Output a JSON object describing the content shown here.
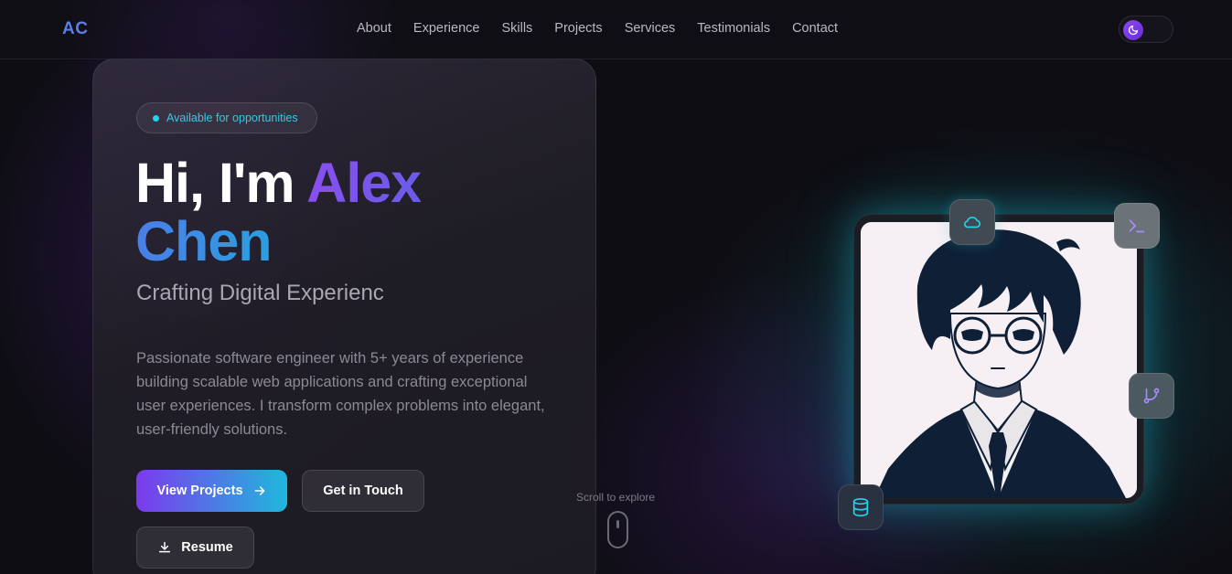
{
  "nav": {
    "logo": "AC",
    "items": [
      {
        "label": "About"
      },
      {
        "label": "Experience"
      },
      {
        "label": "Skills"
      },
      {
        "label": "Projects"
      },
      {
        "label": "Services"
      },
      {
        "label": "Testimonials"
      },
      {
        "label": "Contact"
      }
    ],
    "theme_toggle_icon": "moon-icon"
  },
  "hero": {
    "badge": "Available for opportunities",
    "greeting": "Hi, I'm",
    "first_name": "Alex",
    "last_name": "Chen",
    "subtitle": "Crafting Digital Experienc",
    "description": "Passionate software engineer with 5+ years of experience building scalable web applications and crafting exceptional user experiences. I transform complex problems into elegant, user-friendly solutions.",
    "buttons": {
      "view_projects": "View Projects",
      "get_in_touch": "Get in Touch",
      "resume": "Resume"
    },
    "scroll_label": "Scroll to explore"
  },
  "portrait": {
    "floating_icons": [
      "cloud-icon",
      "terminal-icon",
      "git-branch-icon",
      "database-icon"
    ]
  },
  "colors": {
    "accent_purple": "#7c3aed",
    "accent_cyan": "#22d3ee",
    "logo_blue": "#5a7de8"
  }
}
